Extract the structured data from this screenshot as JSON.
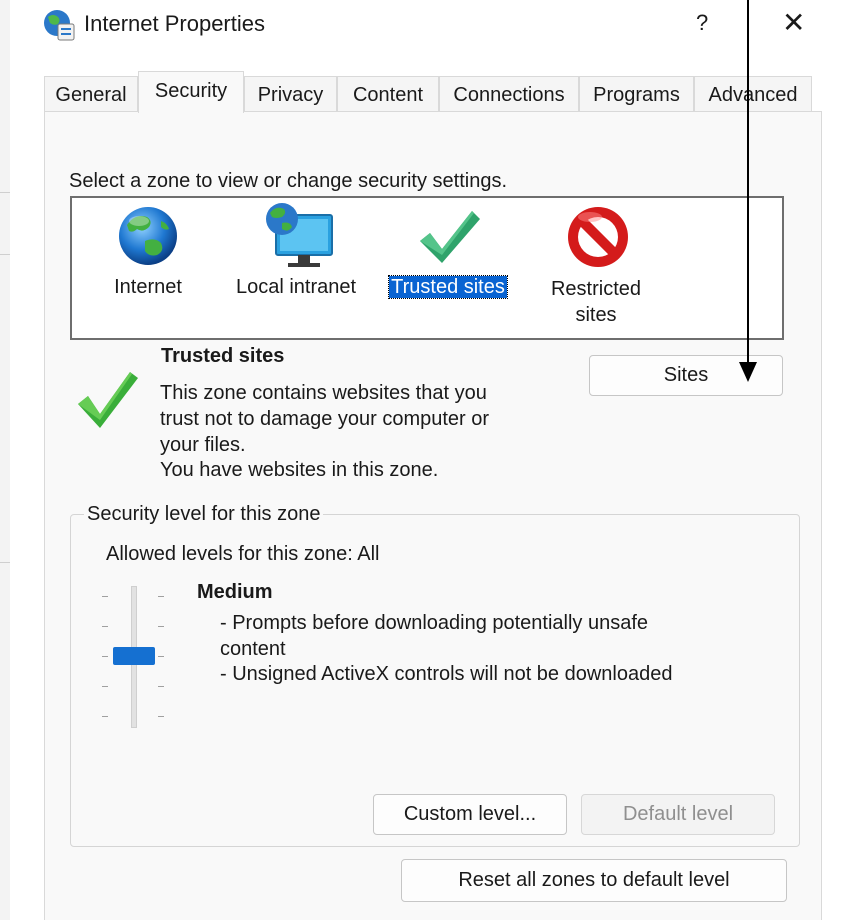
{
  "window": {
    "title": "Internet Properties",
    "help_label": "?",
    "close_label": "✕"
  },
  "tabs": [
    "General",
    "Security",
    "Privacy",
    "Content",
    "Connections",
    "Programs",
    "Advanced"
  ],
  "security": {
    "instruction": "Select a zone to view or change security settings.",
    "zones": [
      {
        "label": "Internet",
        "icon": "globe-icon"
      },
      {
        "label": "Local intranet",
        "icon": "intranet-computer-icon"
      },
      {
        "label": "Trusted sites",
        "icon": "green-check-icon",
        "selected": true
      },
      {
        "label_line1": "Restricted",
        "label_line2": "sites",
        "icon": "restricted-sign-icon"
      }
    ],
    "zone_info": {
      "title": "Trusted sites",
      "line1": "This zone contains websites that you",
      "line2": "trust not to damage your computer or",
      "line3": "your files.",
      "line4": "You have websites in this zone."
    },
    "sites_button": "Sites",
    "level_group_title": "Security level for this zone",
    "allowed_levels": "Allowed levels for this zone: All",
    "level_name": "Medium",
    "level_desc1": "- Prompts before downloading potentially unsafe",
    "level_desc1b": "content",
    "level_desc2": "- Unsigned ActiveX controls will not be downloaded",
    "custom_level_button": "Custom level...",
    "default_level_button": "Default level",
    "reset_button": "Reset all zones to default level",
    "slider_level": 0.5
  },
  "colors": {
    "accent": "#0a64d2",
    "check_green": "#2fa36b",
    "restricted_red": "#d41b1b",
    "annotation_arrow": "#000000"
  }
}
